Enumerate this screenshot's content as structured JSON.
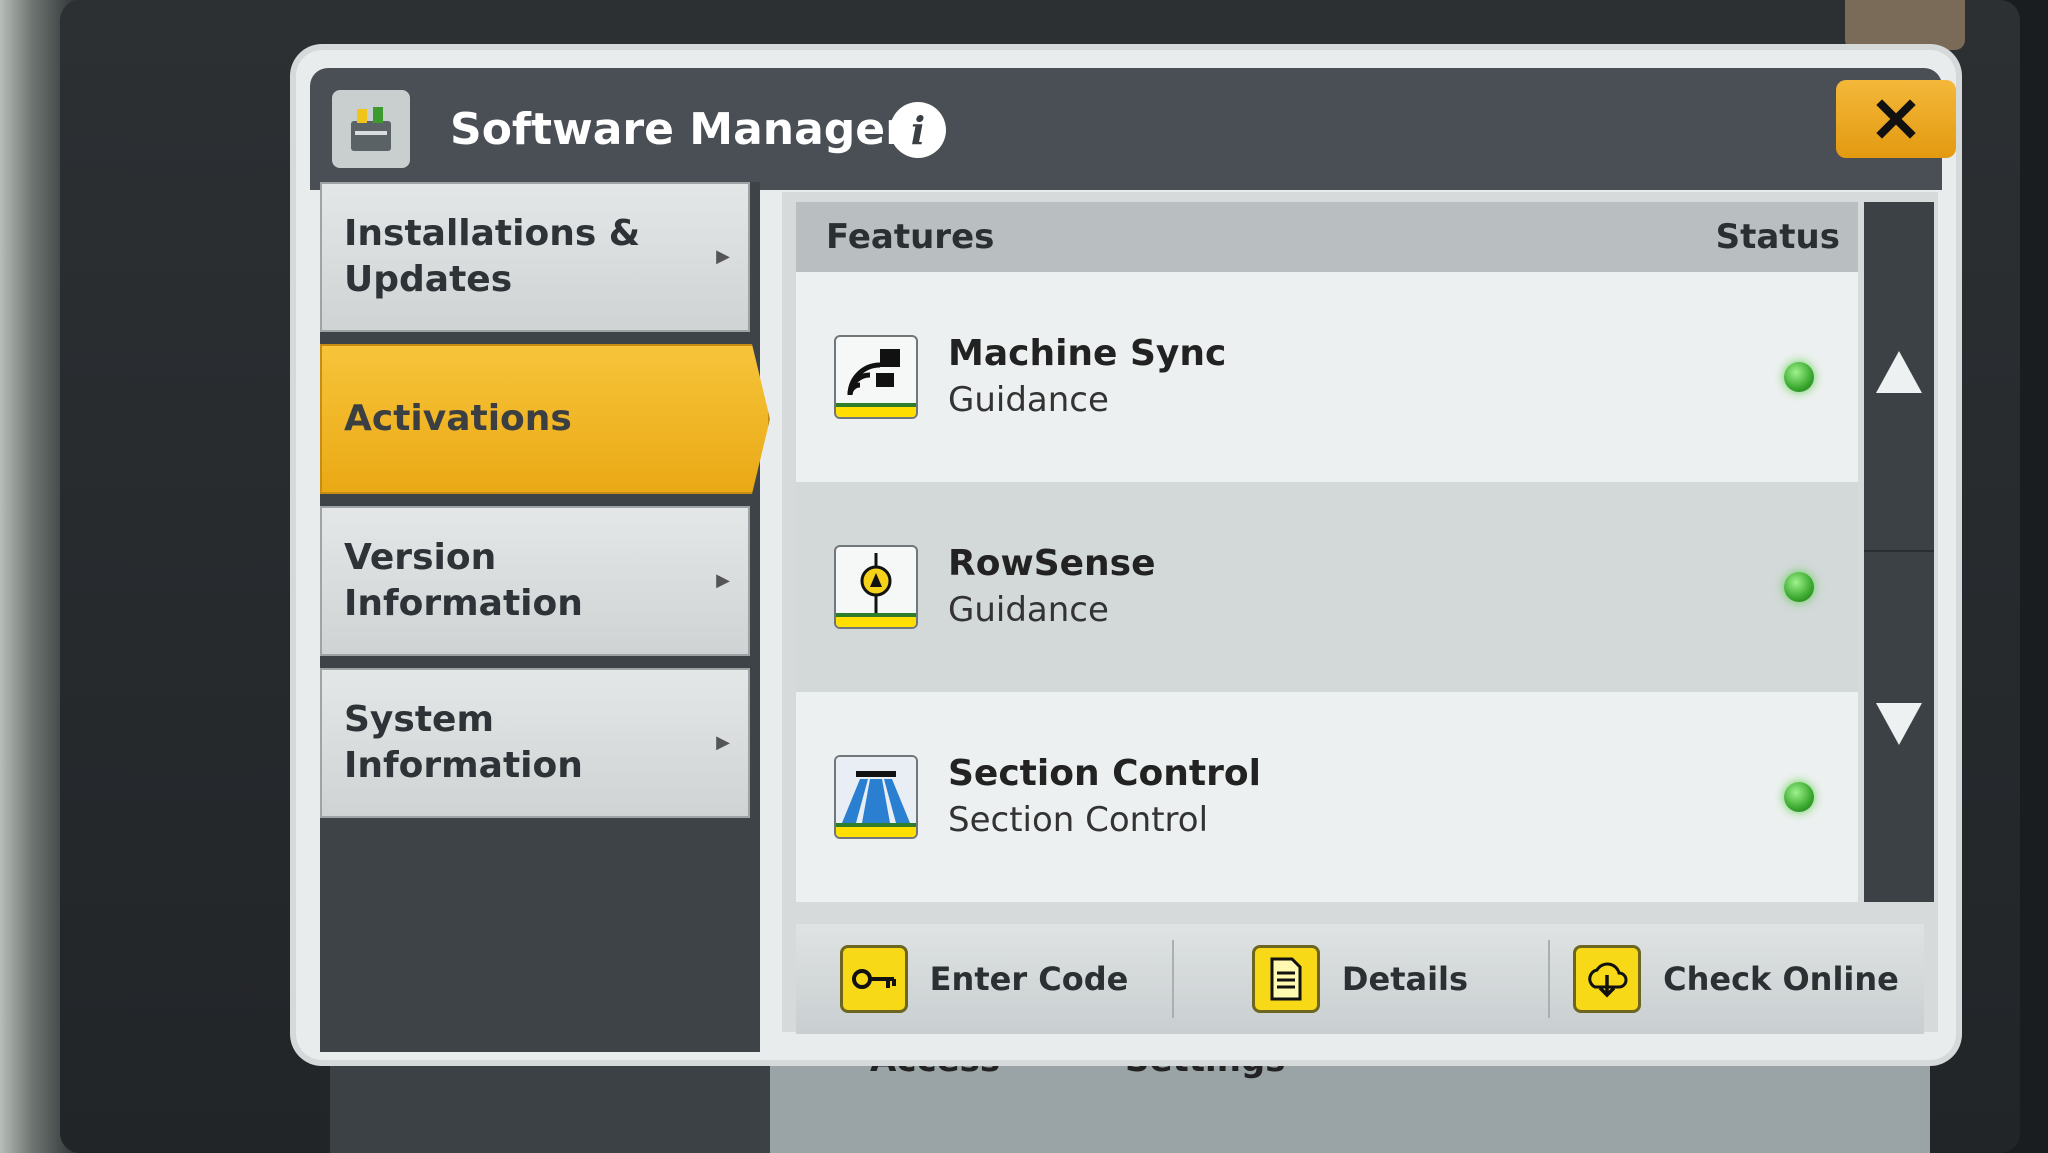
{
  "window": {
    "title": "Software Manager",
    "info_icon": "info-icon",
    "close_icon": "close-icon"
  },
  "nav": {
    "items": [
      {
        "label": "Installations &\nUpdates",
        "active": false
      },
      {
        "label": "Activations",
        "active": true
      },
      {
        "label": "Version\nInformation",
        "active": false
      },
      {
        "label": "System\nInformation",
        "active": false
      }
    ]
  },
  "table": {
    "header_features": "Features",
    "header_status": "Status",
    "rows": [
      {
        "name": "Machine Sync",
        "category": "Guidance",
        "icon": "machine-sync-icon",
        "status": "active"
      },
      {
        "name": "RowSense",
        "category": "Guidance",
        "icon": "rowsense-icon",
        "status": "active"
      },
      {
        "name": "Section Control",
        "category": "Section Control",
        "icon": "section-control-icon",
        "status": "active"
      }
    ]
  },
  "footer": {
    "enter_code": "Enter Code",
    "details": "Details",
    "check_online": "Check Online"
  },
  "background": {
    "partial_text_1": "Access",
    "partial_text_2": "Settings"
  },
  "colors": {
    "accent": "#f0b423",
    "button_yellow": "#f7d917",
    "status_green": "#3aa82e",
    "titlebar": "#4a4f55"
  }
}
